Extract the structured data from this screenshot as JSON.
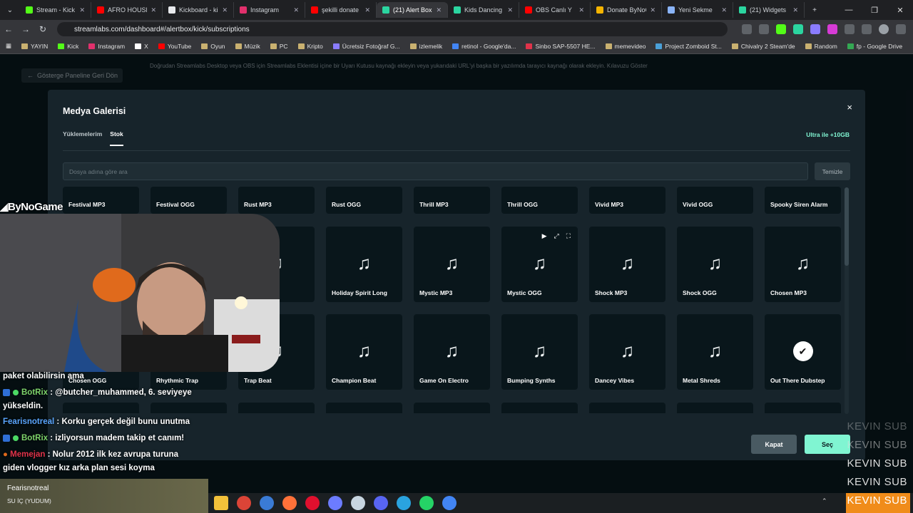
{
  "browser": {
    "tabs": [
      {
        "label": "Stream - Kick",
        "color": "#53fc18"
      },
      {
        "label": "AFRO HOUSE",
        "color": "#ff0000"
      },
      {
        "label": "Kickboard - ki",
        "color": "#e8eaed"
      },
      {
        "label": "Instagram",
        "color": "#e1306c"
      },
      {
        "label": "şekilli donate",
        "color": "#ff0000"
      },
      {
        "label": "(21) Alert Box",
        "color": "#2bd5a0"
      },
      {
        "label": "Kids Dancing",
        "color": "#2bd5a0"
      },
      {
        "label": "OBS Canlı Y",
        "color": "#ff0000"
      },
      {
        "label": "Donate ByNoG",
        "color": "#f5b400"
      },
      {
        "label": "Yeni Sekme",
        "color": "#8ab4f8"
      },
      {
        "label": "(21) Widgets",
        "color": "#2bd5a0"
      }
    ],
    "active_tab_index": 5,
    "new_tab": "+",
    "url": "streamlabs.com/dashboard#/alertbox/kick/subscriptions",
    "bookmarks": [
      "YAYIN",
      "Kick",
      "Instagram",
      "X",
      "YouTube",
      "Oyun",
      "Müzik",
      "PC",
      "Kripto",
      "Ücretsiz Fotoğraf G...",
      "izlemelik",
      "retinol - Google'da...",
      "Sinbo SAP-5507 HE...",
      "memevideo",
      "Project Zomboid St...",
      "Chivalry 2 Steam'de",
      "Random",
      "fp - Google Drive"
    ]
  },
  "page": {
    "back_label": "Gösterge Paneline Geri Dön",
    "info_text": "Doğrudan Streamlabs Desktop veya OBS için Streamlabs Eklentisi içine bir Uyarı Kutusu kaynağı ekleyin veya yukarıdaki URL'yi başka bir yazılımda tarayıcı kaynağı olarak ekleyin. Kılavuzu Göster"
  },
  "modal": {
    "title": "Medya Galerisi",
    "close": "×",
    "tabs": [
      "Yüklemelerim",
      "Stok"
    ],
    "active_tab": "Stok",
    "ultra_label": "Ultra ile +10GB",
    "search_placeholder": "Dosya adına göre ara",
    "clear_label": "Temizle",
    "row1": [
      "Festival MP3",
      "Festival OGG",
      "Rust MP3",
      "Rust OGG",
      "Thrill MP3",
      "Thrill OGG",
      "Vivid MP3",
      "Vivid OGG",
      "Spooky Siren Alarm"
    ],
    "row2": [
      "",
      "",
      "",
      "Holiday Spirit Long",
      "Mystic MP3",
      "Mystic OGG",
      "Shock MP3",
      "Shock OGG",
      "Chosen MP3"
    ],
    "row3": [
      "Chosen OGG",
      "Rhythmic Trap",
      "Trap Beat",
      "Champion Beat",
      "Game On Electro",
      "Bumping Synths",
      "Dancey Vibes",
      "Metal Shreds",
      "Out There Dubstep"
    ],
    "close_label": "Kapat",
    "select_label": "Seç",
    "note_icon": "♫"
  },
  "stream": {
    "brand": "ByNoGame",
    "chat": [
      {
        "user": "",
        "text": "paket olabilirsin ama"
      },
      {
        "user": "BotRix",
        "text": " : @butcher_muhammed, 6. seviyeye"
      },
      {
        "user": "",
        "text": "yükseldin."
      },
      {
        "user": "Fearisnotreal",
        "text": " : Korku gerçek değil bunu unutma"
      },
      {
        "user": "BotRix",
        "text": " : izliyorsun madem takip et canım!"
      },
      {
        "user": "Memejan",
        "text": " : Nolur 2012 ilk kez avrupa turuna"
      },
      {
        "user": "",
        "text": "giden vlogger kız arka plan sesi koyma"
      }
    ],
    "alert_name": "Fearisnotreal",
    "alert_message": "SU İÇ (YUDUM)",
    "subs": [
      "KEVIN SUB",
      "KEVIN SUB",
      "KEVIN SUB",
      "KEVIN SUB",
      "KEVIN SUB"
    ]
  }
}
